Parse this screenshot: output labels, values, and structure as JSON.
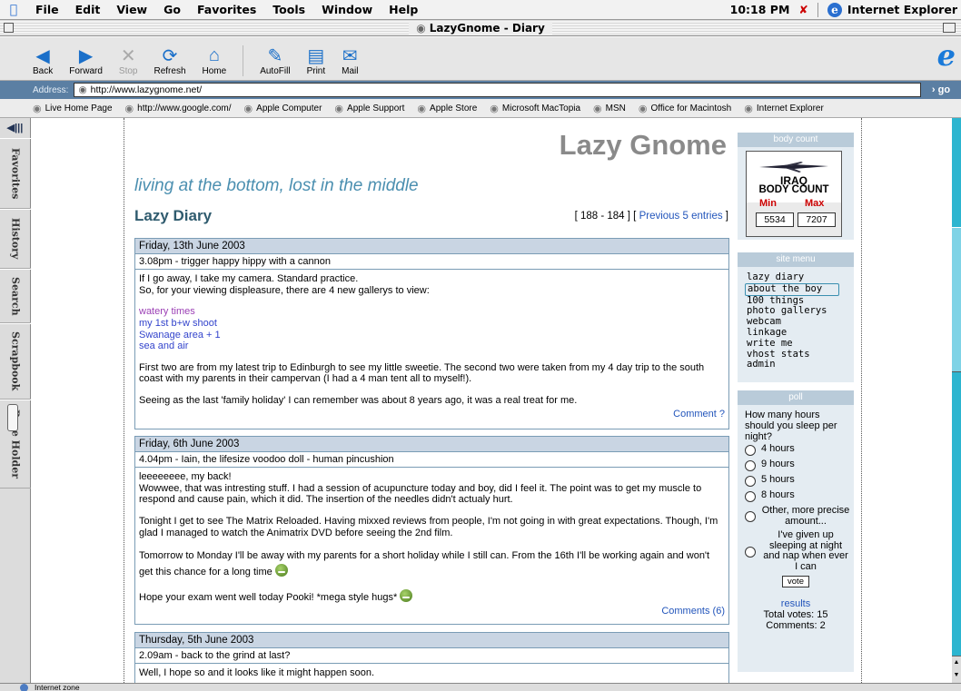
{
  "menubar": {
    "items": [
      "File",
      "Edit",
      "View",
      "Go",
      "Favorites",
      "Tools",
      "Window",
      "Help"
    ],
    "clock": "10:18 PM",
    "app_name": "Internet Explorer"
  },
  "window": {
    "title": "LazyGnome - Diary"
  },
  "toolbar": {
    "buttons": [
      {
        "label": "Back",
        "icon": "back-arrow-icon"
      },
      {
        "label": "Forward",
        "icon": "forward-arrow-icon"
      },
      {
        "label": "Stop",
        "icon": "stop-x-icon"
      },
      {
        "label": "Refresh",
        "icon": "refresh-icon"
      },
      {
        "label": "Home",
        "icon": "home-icon"
      },
      {
        "label": "AutoFill",
        "icon": "autofill-icon"
      },
      {
        "label": "Print",
        "icon": "printer-icon"
      },
      {
        "label": "Mail",
        "icon": "mail-icon"
      }
    ]
  },
  "address": {
    "label": "Address:",
    "url": "http://www.lazygnome.net/",
    "go_label": "go"
  },
  "favorites": [
    "Live Home Page",
    "http://www.google.com/",
    "Apple Computer",
    "Apple Support",
    "Apple Store",
    "Microsoft MacTopia",
    "MSN",
    "Office for Macintosh",
    "Internet Explorer"
  ],
  "explorer_tabs": [
    "Favorites",
    "History",
    "Search",
    "Scrapbook",
    "Page Holder"
  ],
  "site": {
    "title": "Lazy Gnome",
    "tagline": "living at the bottom, lost in the middle",
    "section": "Lazy Diary",
    "pager_range": "[ 188 - 184 ] [ ",
    "pager_link": "Previous 5 entries",
    "pager_end": " ]"
  },
  "entries": [
    {
      "date": "Friday, 13th June 2003",
      "subject": "3.08pm - trigger happy hippy with a cannon",
      "para1_line1": "If I go away, I take my camera. Standard practice.",
      "para1_line2": "So, for your viewing displeasure, there are 4 new gallerys to view:",
      "links": [
        {
          "text": "watery times",
          "color": "#9b3fb5"
        },
        {
          "text": "my 1st b+w shoot",
          "color": "#3344cc"
        },
        {
          "text": "Swanage area + 1",
          "color": "#3344cc"
        },
        {
          "text": "sea and air",
          "color": "#3344cc"
        }
      ],
      "para2": "First two are from my latest trip to Edinburgh to see my little sweetie. The second two were taken from my 4 day trip to the south coast with my parents in their campervan (I had a 4 man tent all to myself!).",
      "para3": "Seeing as the last 'family holiday' I can remember was about 8 years ago, it was a real treat for me.",
      "footer": "Comment ?"
    },
    {
      "date": "Friday, 6th June 2003",
      "subject": "4.04pm - Iain, the lifesize voodoo doll - human pincushion",
      "para1_line1": "leeeeeeee, my back!",
      "para1_line2": "Wowwee, that was intresting stuff. I had a session of acupuncture today and boy, did I feel it. The point was to get my muscle to respond and cause pain, which it did. The insertion of the needles didn't actualy hurt.",
      "para2": "Tonight I get to see The Matrix Reloaded. Having mixxed reviews from people, I'm not going in with great expectations. Though, I'm glad I managed to watch the Animatrix DVD before seeing the 2nd film.",
      "para3": "Tomorrow to Monday I'll be away with my parents for a short holiday while I still can. From the 16th I'll be working again and won't get this chance for a long time",
      "para4": "Hope your exam went well today Pooki! *mega style hugs*",
      "footer": "Comments (6)"
    },
    {
      "date": "Thursday, 5th June 2003",
      "subject": "2.09am - back to the grind at last?",
      "para1_line1": "Well, I hope so and it looks like it might happen soon."
    }
  ],
  "sidebar": {
    "body_count": {
      "header": "body count",
      "title_line1": "IRAQ",
      "title_line2": "BODY COUNT",
      "min_label": "Min",
      "max_label": "Max",
      "min_value": "5534",
      "max_value": "7207"
    },
    "menu": {
      "header": "site menu",
      "items": [
        "lazy diary",
        "about the boy",
        "100 things",
        "photo gallerys",
        "webcam",
        "linkage",
        "write me",
        "vhost stats",
        "admin"
      ]
    },
    "poll": {
      "header": "poll",
      "question": "How many hours should you sleep per night?",
      "options": [
        "4 hours",
        "9 hours",
        "5 hours",
        "8 hours",
        "Other, more precise amount...",
        "I've given up sleeping at night and nap when ever I can"
      ],
      "vote_label": "vote",
      "results_label": "results",
      "total_votes": "Total votes: 15",
      "comments": "Comments: 2"
    }
  },
  "status": {
    "zone": "Internet zone"
  }
}
